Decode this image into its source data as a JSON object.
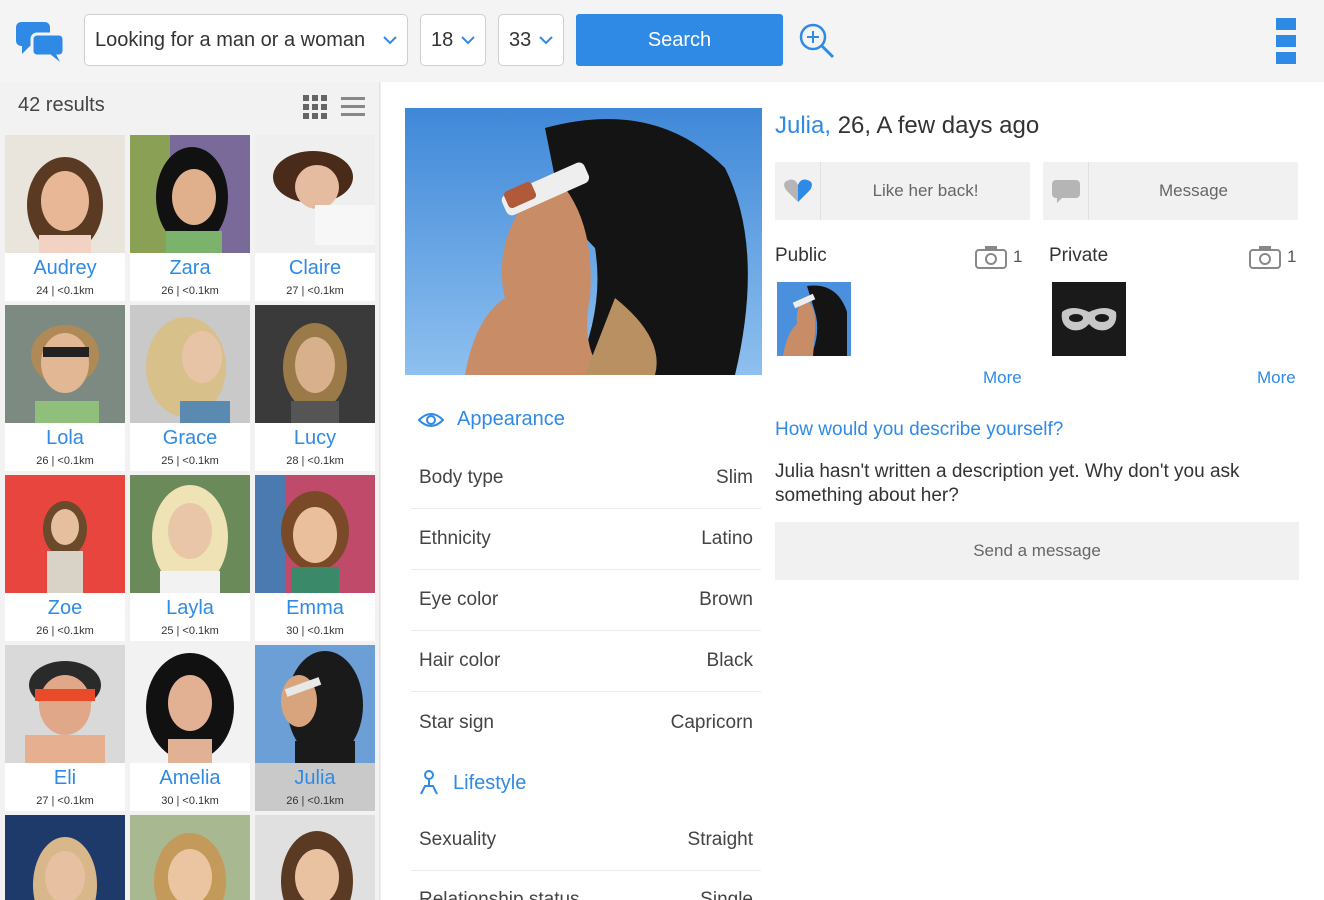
{
  "topbar": {
    "gender_select": "Looking for a man or a woman",
    "age_min": "18",
    "age_max": "33",
    "search_label": "Search"
  },
  "results": {
    "count_label": "42 results",
    "profiles": [
      {
        "name": "Audrey",
        "meta": "24 | <0.1km"
      },
      {
        "name": "Zara",
        "meta": "26 | <0.1km"
      },
      {
        "name": "Claire",
        "meta": "27 | <0.1km"
      },
      {
        "name": "Lola",
        "meta": "26 | <0.1km"
      },
      {
        "name": "Grace",
        "meta": "25 | <0.1km"
      },
      {
        "name": "Lucy",
        "meta": "28 | <0.1km"
      },
      {
        "name": "Zoe",
        "meta": "26 | <0.1km"
      },
      {
        "name": "Layla",
        "meta": "25 | <0.1km"
      },
      {
        "name": "Emma",
        "meta": "30 | <0.1km"
      },
      {
        "name": "Eli",
        "meta": "27 | <0.1km"
      },
      {
        "name": "Amelia",
        "meta": "30 | <0.1km"
      },
      {
        "name": "Julia",
        "meta": "26 | <0.1km"
      }
    ]
  },
  "profile": {
    "name": "Julia,",
    "title_rest": " 26, A few days ago",
    "like_label": "Like her back!",
    "message_label": "Message",
    "public_label": "Public",
    "public_count": "1",
    "private_label": "Private",
    "private_count": "1",
    "more_label": "More",
    "question": "How would you describe yourself?",
    "description": "Julia hasn't written a description yet. Why don't you ask something about her?",
    "send_label": "Send a message",
    "appearance_label": "Appearance",
    "lifestyle_label": "Lifestyle",
    "attributes": [
      {
        "label": "Body type",
        "value": "Slim"
      },
      {
        "label": "Ethnicity",
        "value": "Latino"
      },
      {
        "label": "Eye color",
        "value": "Brown"
      },
      {
        "label": "Hair color",
        "value": "Black"
      },
      {
        "label": "Star sign",
        "value": "Capricorn"
      }
    ],
    "lifestyle": [
      {
        "label": "Sexuality",
        "value": "Straight"
      },
      {
        "label": "Relationship status",
        "value": "Single"
      }
    ]
  },
  "colors": {
    "accent": "#2f8ae6",
    "background": "#f2f2f2"
  }
}
